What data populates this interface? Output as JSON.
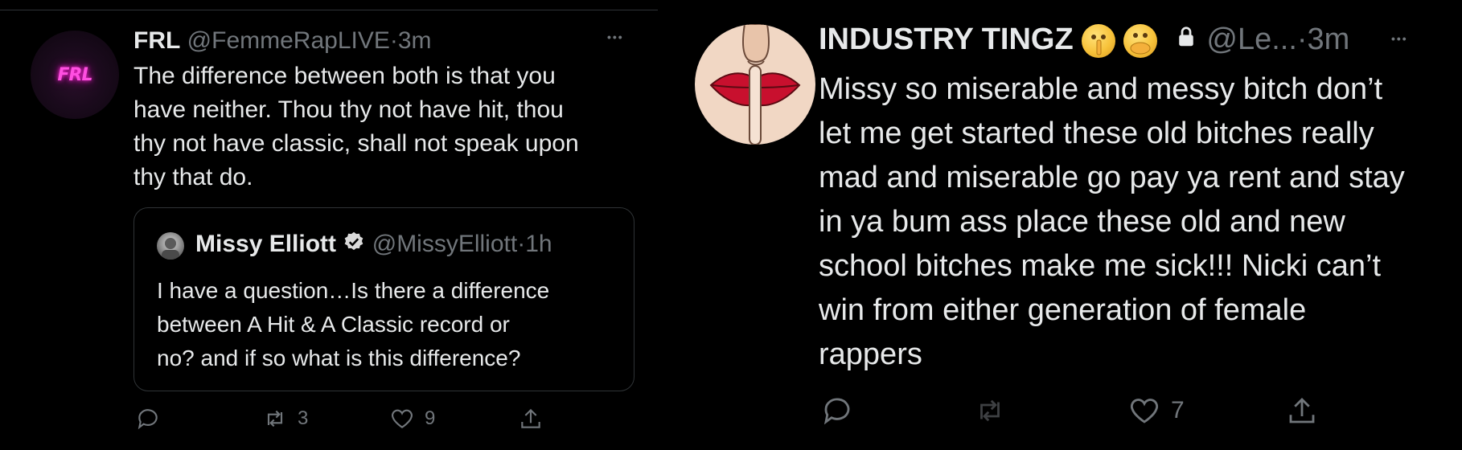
{
  "left_tweet": {
    "avatar_text": "FRL",
    "name": "FRL",
    "handle": "@FemmeRapLIVE",
    "separator": "·",
    "time": "3m",
    "more": "•••",
    "lines": [
      "The difference between both is that you",
      "have neither. Thou thy not have hit, thou",
      "thy not have classic, shall not speak upon",
      "thy that do."
    ],
    "quote": {
      "name": "Missy Elliott",
      "handle": "@MissyElliott",
      "separator": "·",
      "time": "1h",
      "lines": [
        "I have a question…Is there a difference",
        "between A Hit & A Classic record or",
        "no? and if so what is this difference?"
      ]
    },
    "actions": {
      "reply_icon": "reply-icon",
      "retweet_icon": "retweet-icon",
      "retweet_count": "3",
      "like_icon": "heart-icon",
      "like_count": "9",
      "share_icon": "share-icon"
    }
  },
  "right_tweet": {
    "name": "INDUSTRY TINGZ",
    "emojis": [
      "shushing-face-emoji",
      "face-with-open-eyes-and-hand-over-mouth-emoji"
    ],
    "lock_icon": "lock-icon",
    "handle": "@Le...",
    "separator": "·",
    "time": "3m",
    "more": "•••",
    "lines": [
      "Missy so miserable and messy bitch don’t",
      "let me get started these old bitches really",
      "mad and miserable go pay ya rent and stay",
      "in ya bum ass place these old and new",
      "school bitches make me sick!!! Nicki can’t",
      "win from either generation of female",
      "rappers"
    ],
    "actions": {
      "reply_icon": "reply-icon",
      "retweet_icon": "retweet-icon",
      "like_icon": "heart-icon",
      "like_count": "7",
      "share_icon": "share-icon"
    }
  },
  "colors": {
    "background": "#000000",
    "text": "#e7e9ea",
    "muted": "#71767b",
    "border": "#2f3336",
    "frl_neon": "#ff4fe1",
    "lips": "#c8102e"
  }
}
